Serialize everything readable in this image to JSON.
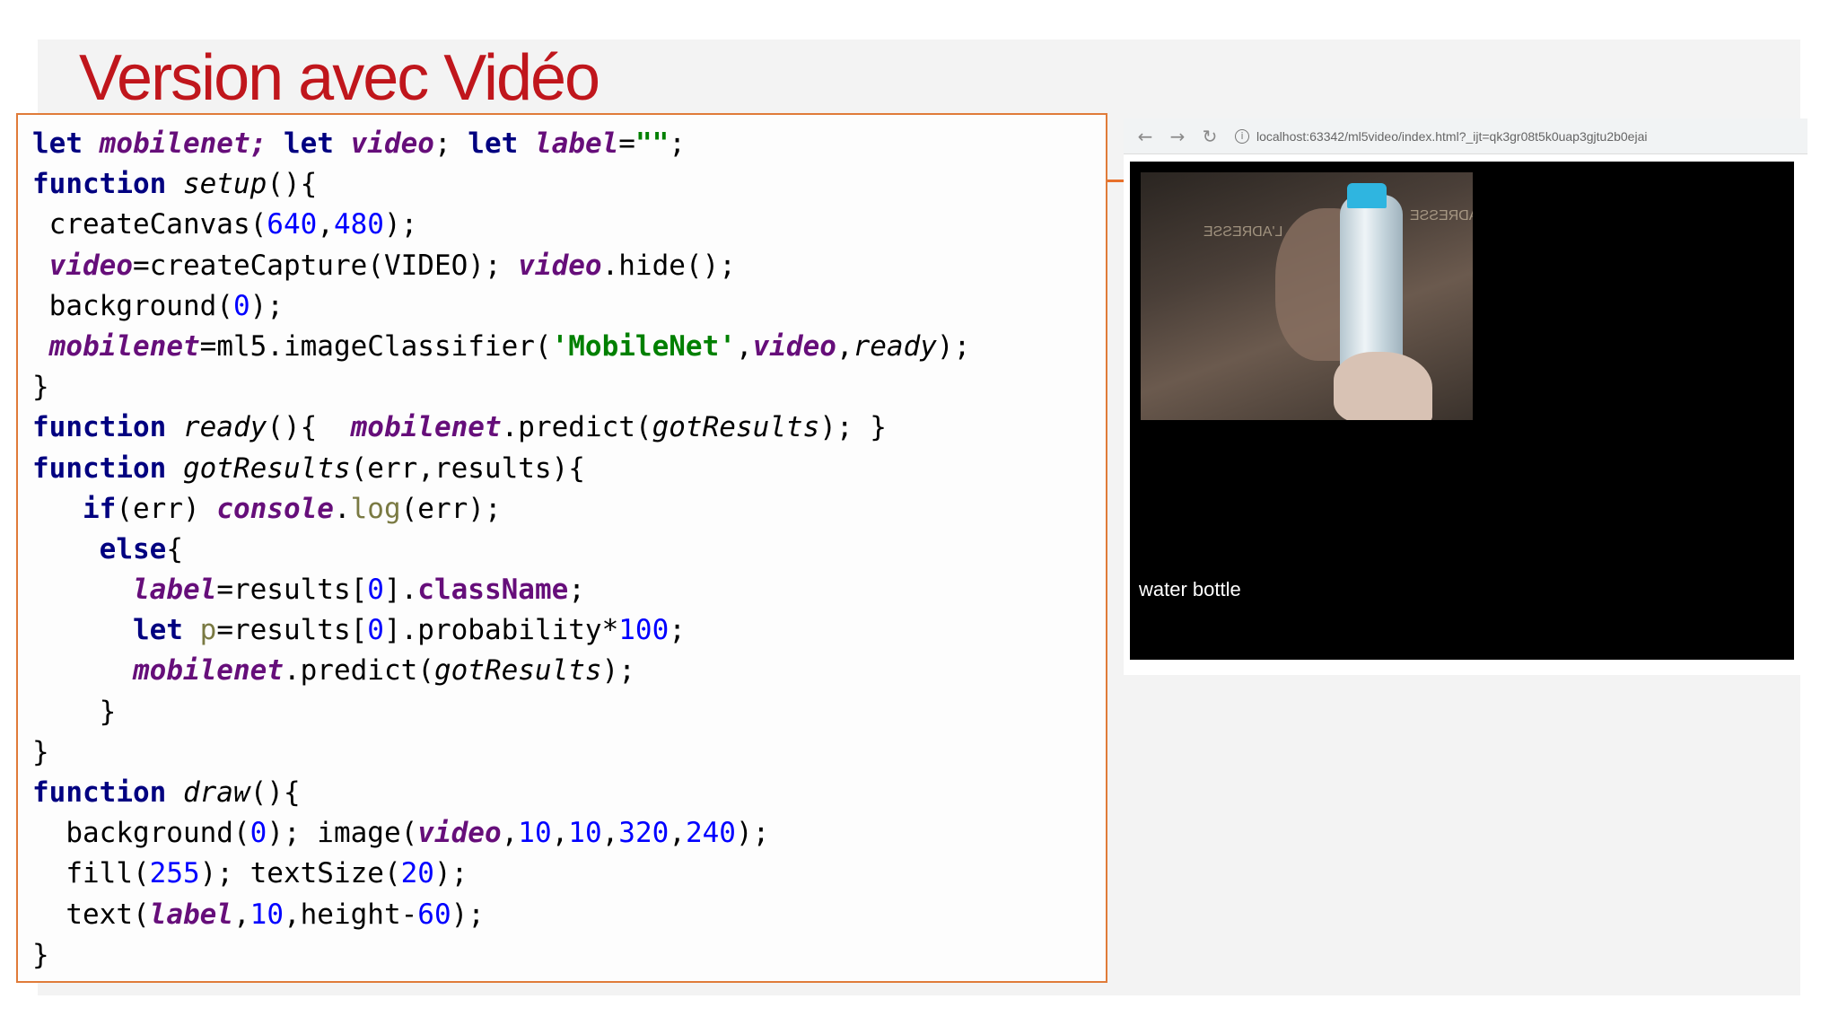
{
  "slide": {
    "title": "Version avec Vidéo"
  },
  "code": {
    "lines": [
      "let mobilenet; let video; let label=\"\";",
      "function setup(){",
      " createCanvas(640,480);",
      " video=createCapture(VIDEO); video.hide();",
      " background(0);",
      " mobilenet=ml5.imageClassifier('MobileNet',video,ready);",
      "}",
      "function ready(){  mobilenet.predict(gotResults); }",
      "function gotResults(err,results){",
      "   if(err) console.log(err);",
      "    else{",
      "      label=results[0].className;",
      "      let p=results[0].probability*100;",
      "      mobilenet.predict(gotResults);",
      "    }",
      "}",
      "function draw(){",
      "  background(0); image(video,10,10,320,240);",
      "  fill(255); textSize(20);",
      "  text(label,10,height-60);",
      "}"
    ]
  },
  "browser": {
    "back_icon": "arrow-left-icon",
    "forward_icon": "arrow-right-icon",
    "reload_icon": "reload-icon",
    "url": "localhost:63342/ml5video/index.html?_ijt=qk3gr08t5k0uap3gjtu2b0ejai"
  },
  "canvas": {
    "label": "water bottle",
    "video_sign_left": "L'ADRESSE",
    "video_sign_right": "L'ADRESSE"
  },
  "colors": {
    "title": "#c0161c",
    "code_border": "#e07b39",
    "keyword": "#000080",
    "global_var": "#660e7a",
    "number": "#0000ff",
    "string": "#008000"
  }
}
